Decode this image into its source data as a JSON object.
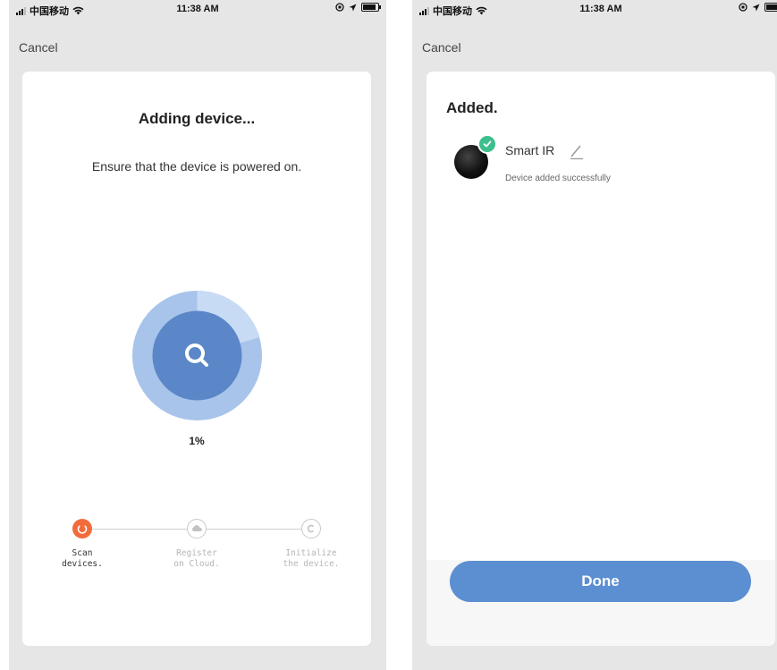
{
  "left_screen": {
    "status_bar": {
      "carrier": "中国移动",
      "time": "11:38 AM"
    },
    "cancel_label": "Cancel",
    "title": "Adding device...",
    "subtitle": "Ensure that the device is powered on.",
    "progress": {
      "percent_label": "1%",
      "value": 0.01,
      "radar_icon": "search-icon"
    },
    "steps": [
      {
        "label_line1": "Scan",
        "label_line2": "devices.",
        "state": "active",
        "icon": "power-icon"
      },
      {
        "label_line1": "Register",
        "label_line2": "on Cloud.",
        "state": "inactive",
        "icon": "cloud-icon"
      },
      {
        "label_line1": "Initialize",
        "label_line2": "the device.",
        "state": "inactive",
        "icon": "c-icon"
      }
    ],
    "colors": {
      "accent": "#f26b3a",
      "radar_inner": "#5b87c8",
      "radar_outer": "#a8c4ea"
    }
  },
  "right_screen": {
    "status_bar": {
      "carrier": "中国移动",
      "time": "11:38 AM"
    },
    "cancel_label": "Cancel",
    "title": "Added.",
    "device": {
      "name": "Smart IR",
      "status": "Device added successfully",
      "badge_icon": "check-icon",
      "edit_icon": "pencil-icon"
    },
    "done_label": "Done",
    "colors": {
      "done_button": "#5c8fd1",
      "success": "#3dbf8c"
    }
  }
}
